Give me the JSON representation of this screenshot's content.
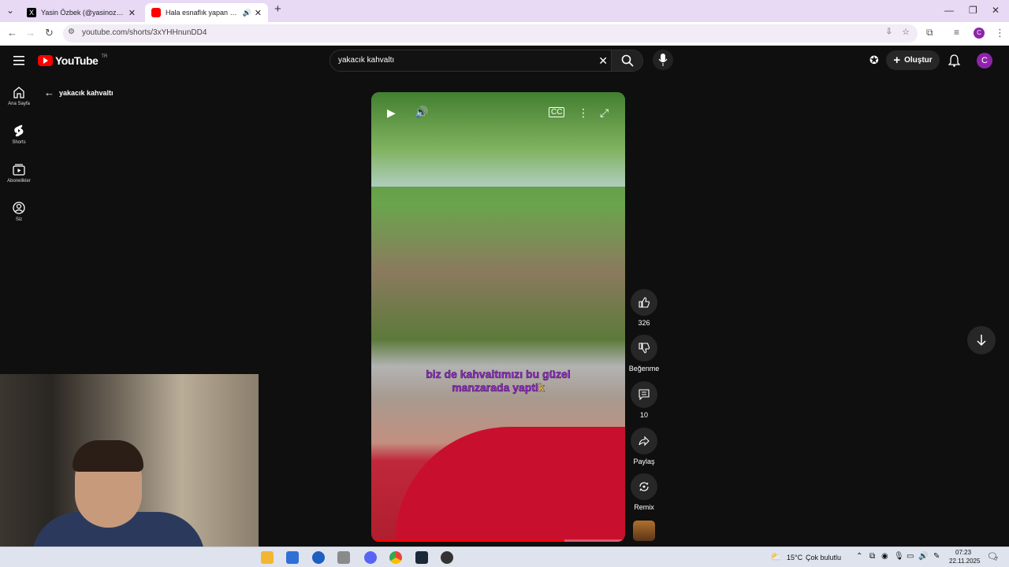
{
  "browser": {
    "tabs": [
      {
        "title": "Yasin Özbek (@yasinozbek_) / X"
      },
      {
        "title": "Hala esnaflık yapan Eşref Ağabey"
      }
    ],
    "url": "youtube.com/shorts/3xYHHnunDD4"
  },
  "youtube": {
    "logo_text": "YouTube",
    "country_code": "TR",
    "search_query": "yakacık kahvaltı",
    "create_label": "Oluştur",
    "avatar_letter": "C",
    "sidebar": [
      {
        "label": "Ana Sayfa",
        "icon": "home-icon"
      },
      {
        "label": "Shorts",
        "icon": "shorts-icon"
      },
      {
        "label": "Abonelikler",
        "icon": "subscriptions-icon"
      },
      {
        "label": "Siz",
        "icon": "account-icon"
      }
    ],
    "back_label": "yakacık kahvaltı",
    "subtitle_line1": "biz de kahvaltımızı bu güzel",
    "subtitle_line2_a": "manzarada yapti",
    "subtitle_line2_b": "k",
    "progress_fraction": 0.76,
    "actions": {
      "like_count": "326",
      "dislike_label": "Beğenme",
      "comments_count": "10",
      "share_label": "Paylaş",
      "remix_label": "Remix"
    }
  },
  "taskbar": {
    "weather_temp": "15°C",
    "weather_desc": "Çok bulutlu",
    "time": "07:23",
    "date": "22.11.2025",
    "notification_count": "7"
  },
  "colors": {
    "youtube_red": "#ff0000",
    "tab_bar": "#e8d9f5",
    "avatar": "#8e24aa",
    "subtitle": "#9b30d0",
    "subtitle_highlight": "#f3e34a"
  }
}
